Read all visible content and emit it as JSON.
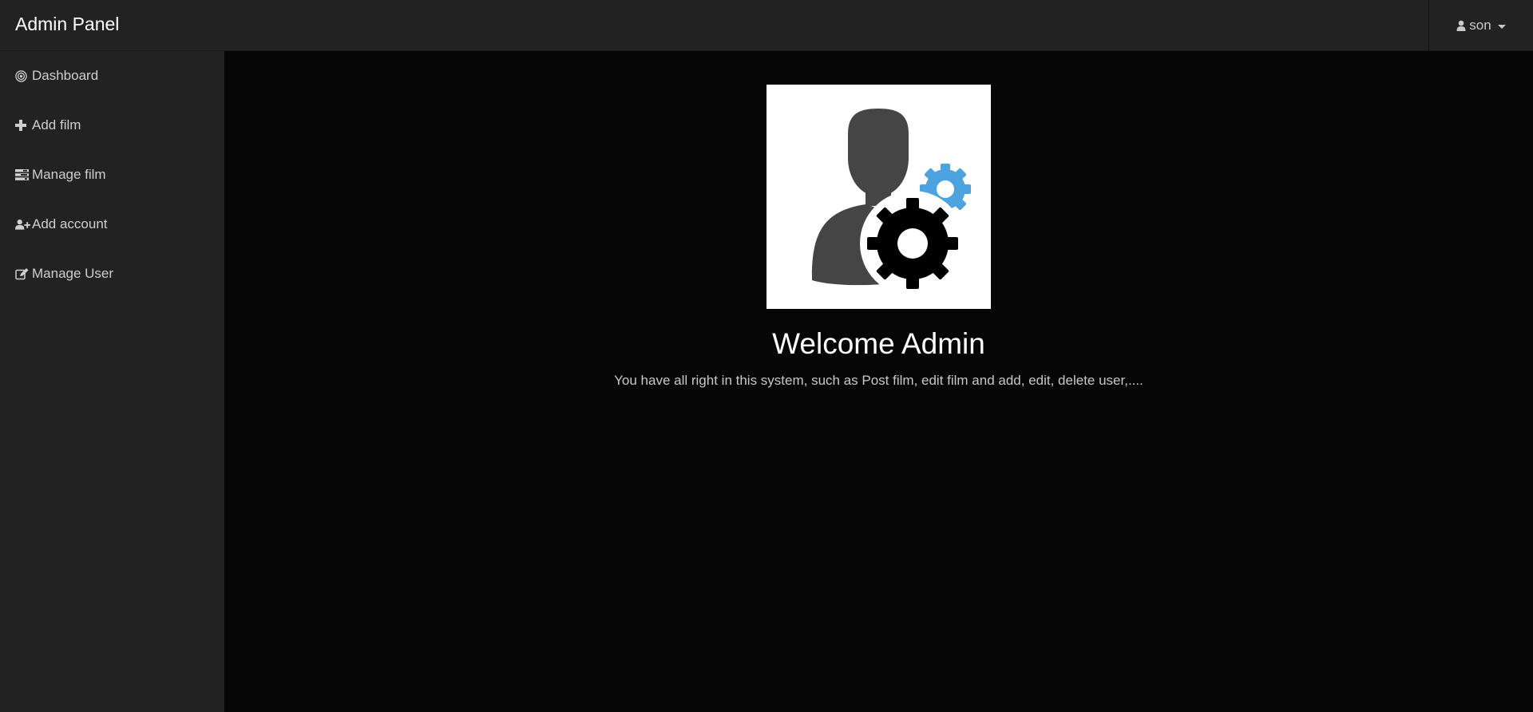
{
  "header": {
    "brand": "Admin Panel",
    "user": {
      "name": "son",
      "icon": "user-icon"
    }
  },
  "sidebar": {
    "items": [
      {
        "label": "Dashboard",
        "icon": "dashboard-icon"
      },
      {
        "label": "Add film",
        "icon": "plus-icon"
      },
      {
        "label": "Manage film",
        "icon": "tasks-icon"
      },
      {
        "label": "Add account",
        "icon": "user-plus-icon"
      },
      {
        "label": "Manage User",
        "icon": "edit-icon"
      }
    ]
  },
  "main": {
    "image": "admin-settings-illustration",
    "title": "Welcome Admin",
    "description": "You have all right in this system, such as Post film, edit film and add, edit, delete user,...."
  },
  "colors": {
    "topbar": "#222222",
    "sidebar": "#222222",
    "main_bg": "#060606",
    "gear_blue": "#4da3e0"
  }
}
